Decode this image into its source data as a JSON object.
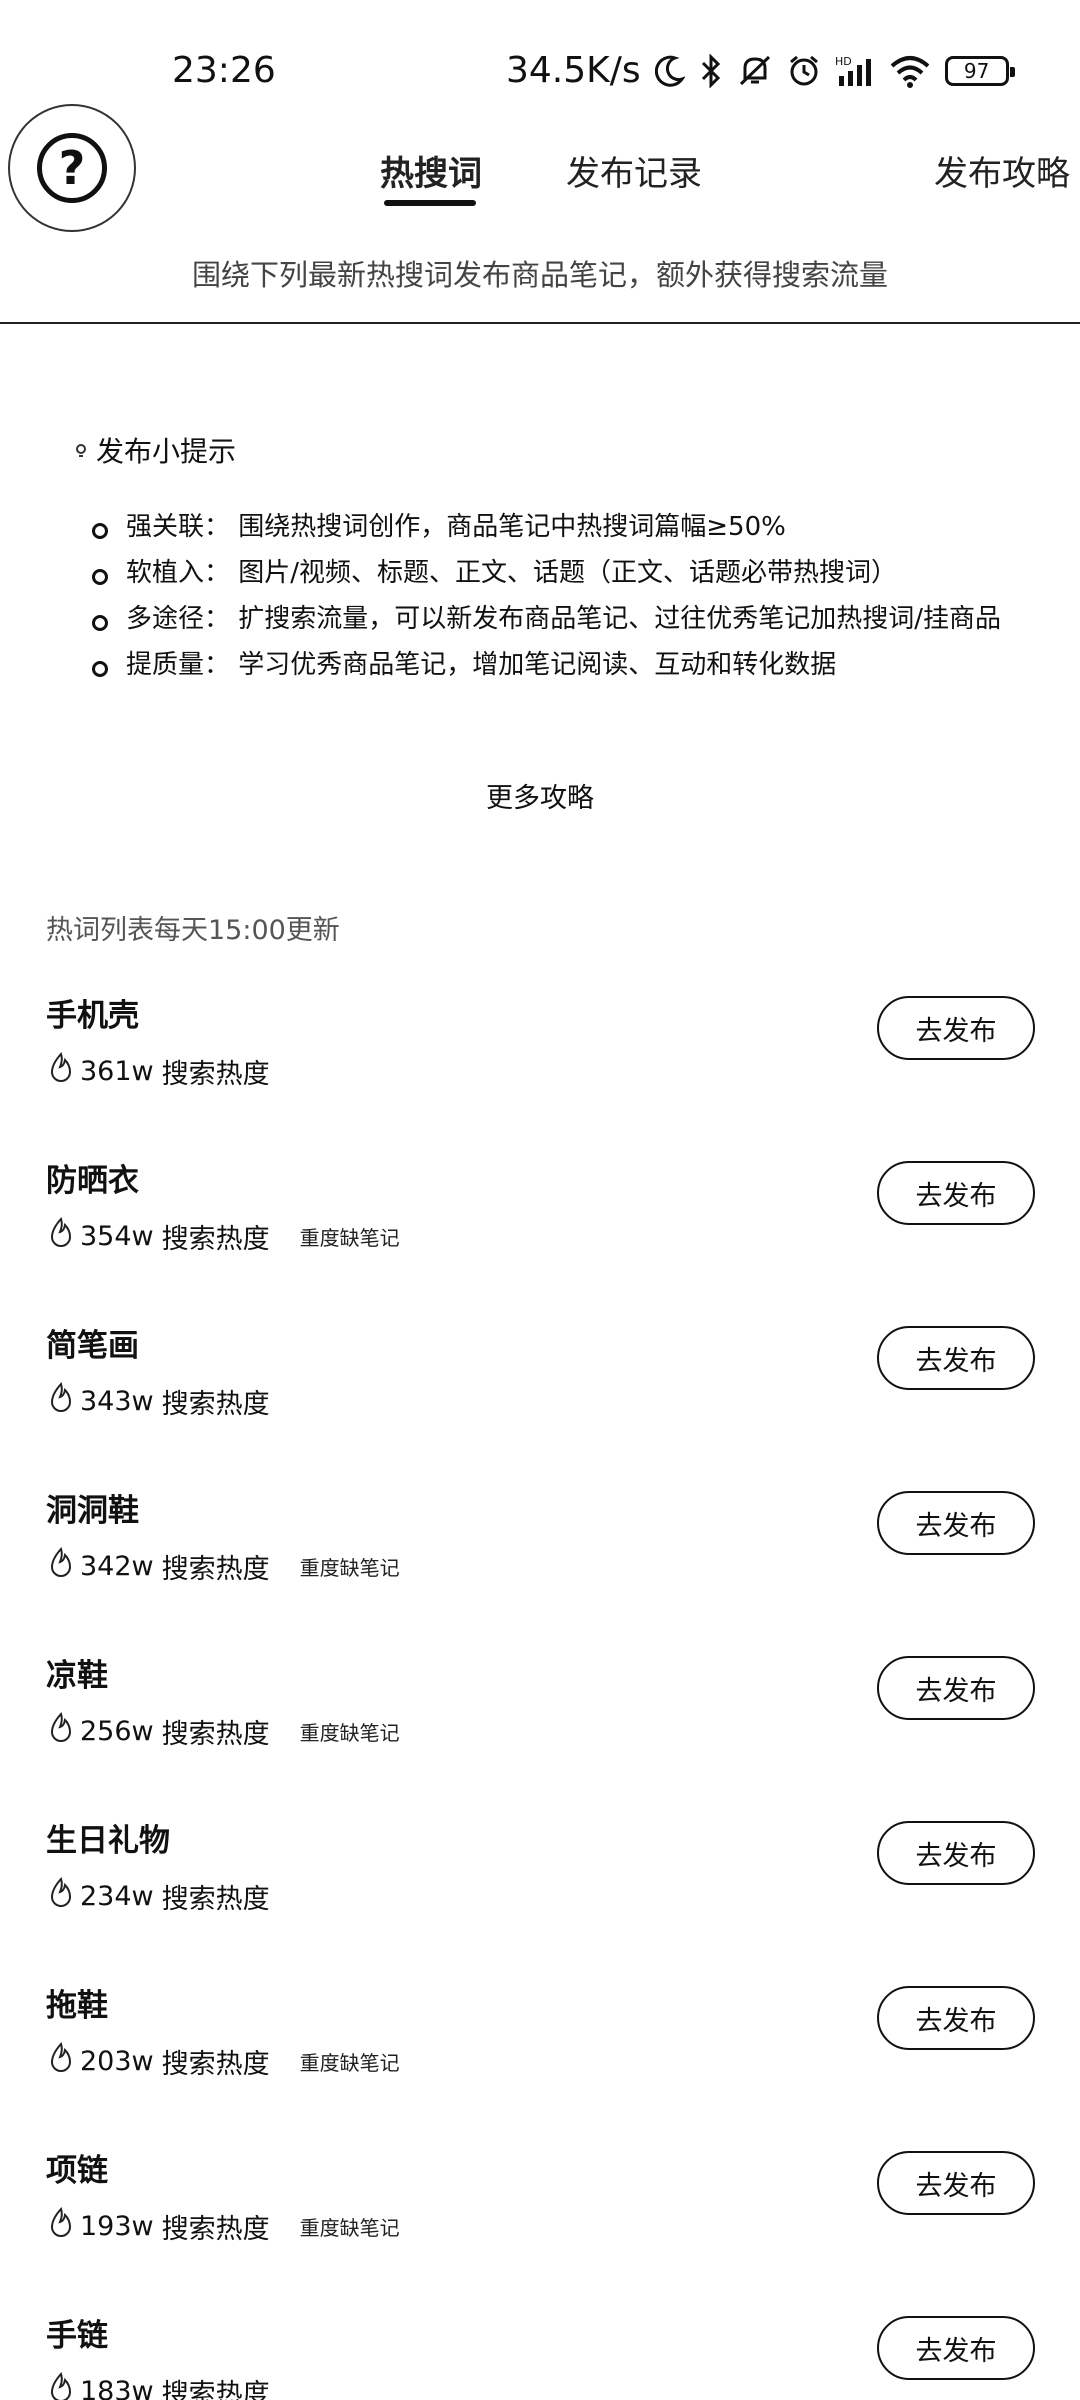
{
  "status": {
    "time": "23:26",
    "speed": "34.5K/s",
    "battery": "97"
  },
  "tabs": [
    {
      "label": "热搜词"
    },
    {
      "label": "发布记录"
    },
    {
      "label": "发布攻略"
    }
  ],
  "subtitle": "围绕下列最新热搜词发布商品笔记，额外获得搜索流量",
  "tips": {
    "title": "发布小提示",
    "items": [
      {
        "text": "强关联：  围绕热搜词创作，商品笔记中热搜词篇幅≥50%"
      },
      {
        "text": "软植入：  图片/视频、标题、正文、话题（正文、话题必带热搜词）"
      },
      {
        "text": "多途径：  扩搜索流量，可以新发布商品笔记、过往优秀笔记加热搜词/挂商品"
      },
      {
        "text": "提质量：  学习优秀商品笔记，增加笔记阅读、互动和转化数据"
      }
    ],
    "more_link": "更多攻略"
  },
  "hotlist": {
    "update_note": "热词列表每天15:00更新",
    "heat_label": "搜索热度",
    "button_label": "去发布",
    "items": [
      {
        "word": "手机壳",
        "heat": "361w",
        "badge": ""
      },
      {
        "word": "防晒衣",
        "heat": "354w",
        "badge": "重度缺笔记"
      },
      {
        "word": "简笔画",
        "heat": "343w",
        "badge": ""
      },
      {
        "word": "洞洞鞋",
        "heat": "342w",
        "badge": "重度缺笔记"
      },
      {
        "word": "凉鞋",
        "heat": "256w",
        "badge": "重度缺笔记"
      },
      {
        "word": "生日礼物",
        "heat": "234w",
        "badge": ""
      },
      {
        "word": "拖鞋",
        "heat": "203w",
        "badge": "重度缺笔记"
      },
      {
        "word": "项链",
        "heat": "193w",
        "badge": "重度缺笔记"
      },
      {
        "word": "手链",
        "heat": "183w",
        "badge": ""
      }
    ]
  }
}
